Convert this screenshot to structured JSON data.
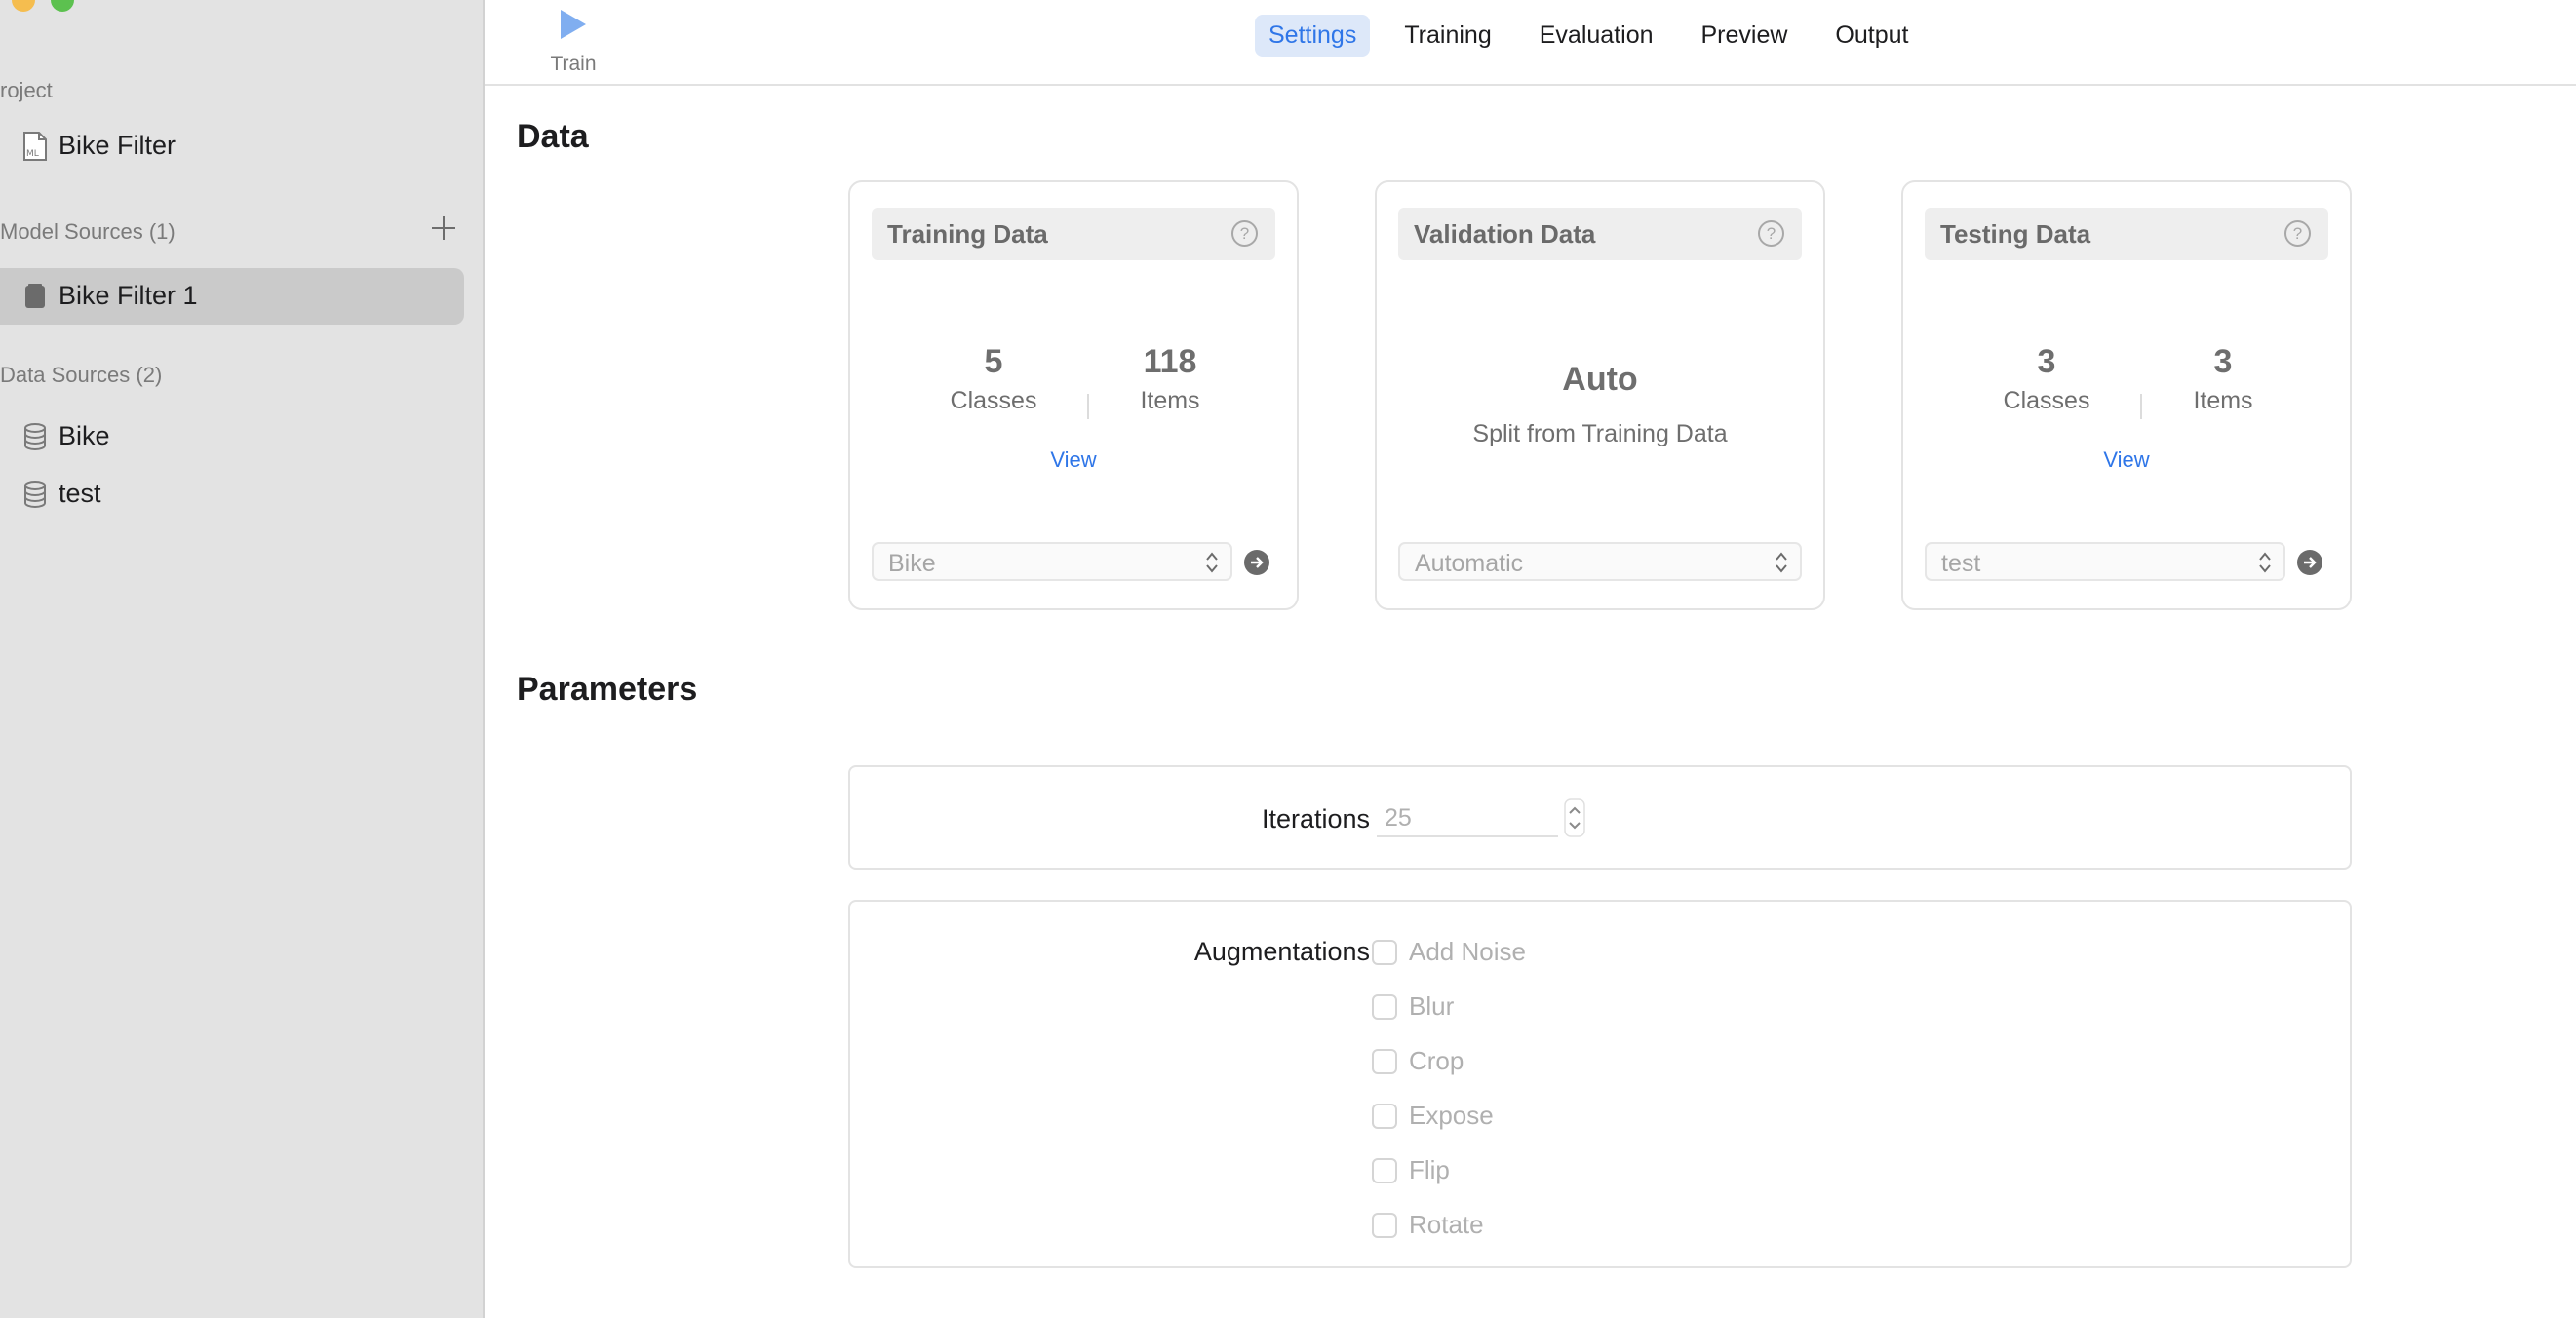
{
  "sidebar": {
    "project_label": "roject",
    "project_item": "Bike Filter",
    "model_sources_label": "Model Sources (1)",
    "model_item": "Bike Filter 1",
    "data_sources_label": "Data Sources (2)",
    "data_items": [
      "Bike",
      "test"
    ]
  },
  "toolbar": {
    "train_label": "Train",
    "tabs": [
      "Settings",
      "Training",
      "Evaluation",
      "Preview",
      "Output"
    ],
    "active_tab": "Settings"
  },
  "data_section": {
    "title": "Data",
    "training": {
      "title": "Training Data",
      "classes": "5",
      "classes_label": "Classes",
      "items": "118",
      "items_label": "Items",
      "view": "View",
      "select_value": "Bike"
    },
    "validation": {
      "title": "Validation Data",
      "main": "Auto",
      "sub": "Split from Training Data",
      "select_value": "Automatic"
    },
    "testing": {
      "title": "Testing Data",
      "classes": "3",
      "classes_label": "Classes",
      "items": "3",
      "items_label": "Items",
      "view": "View",
      "select_value": "test"
    },
    "help_glyph": "?"
  },
  "parameters": {
    "title": "Parameters",
    "iterations_label": "Iterations",
    "iterations_value": "25",
    "augmentations_label": "Augmentations",
    "augmentations": [
      "Add Noise",
      "Blur",
      "Crop",
      "Expose",
      "Flip",
      "Rotate"
    ]
  }
}
